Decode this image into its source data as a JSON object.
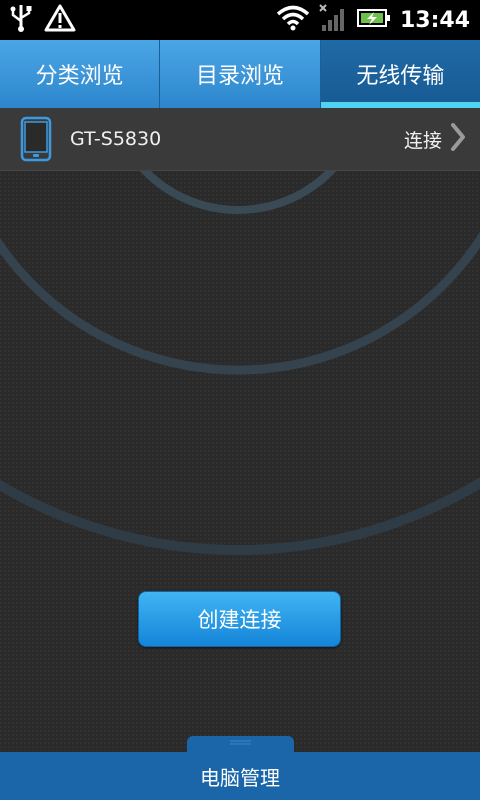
{
  "status_bar": {
    "time": "13:44",
    "icons": [
      "usb-icon",
      "warning-icon",
      "wifi-icon",
      "signal-icon",
      "battery-charging-icon"
    ]
  },
  "tabs": [
    {
      "label": "分类浏览",
      "active": false
    },
    {
      "label": "目录浏览",
      "active": false
    },
    {
      "label": "无线传输",
      "active": true
    }
  ],
  "device": {
    "name": "GT-S5830",
    "action_label": "连接",
    "icon": "phone-icon"
  },
  "create_button": {
    "label": "创建连接"
  },
  "bottom_bar": {
    "label": "电脑管理"
  },
  "colors": {
    "accent": "#2d86cc",
    "tab_indicator": "#4fd3f0",
    "background": "#2b2b2b",
    "bottom_bar": "#1a66a8"
  }
}
